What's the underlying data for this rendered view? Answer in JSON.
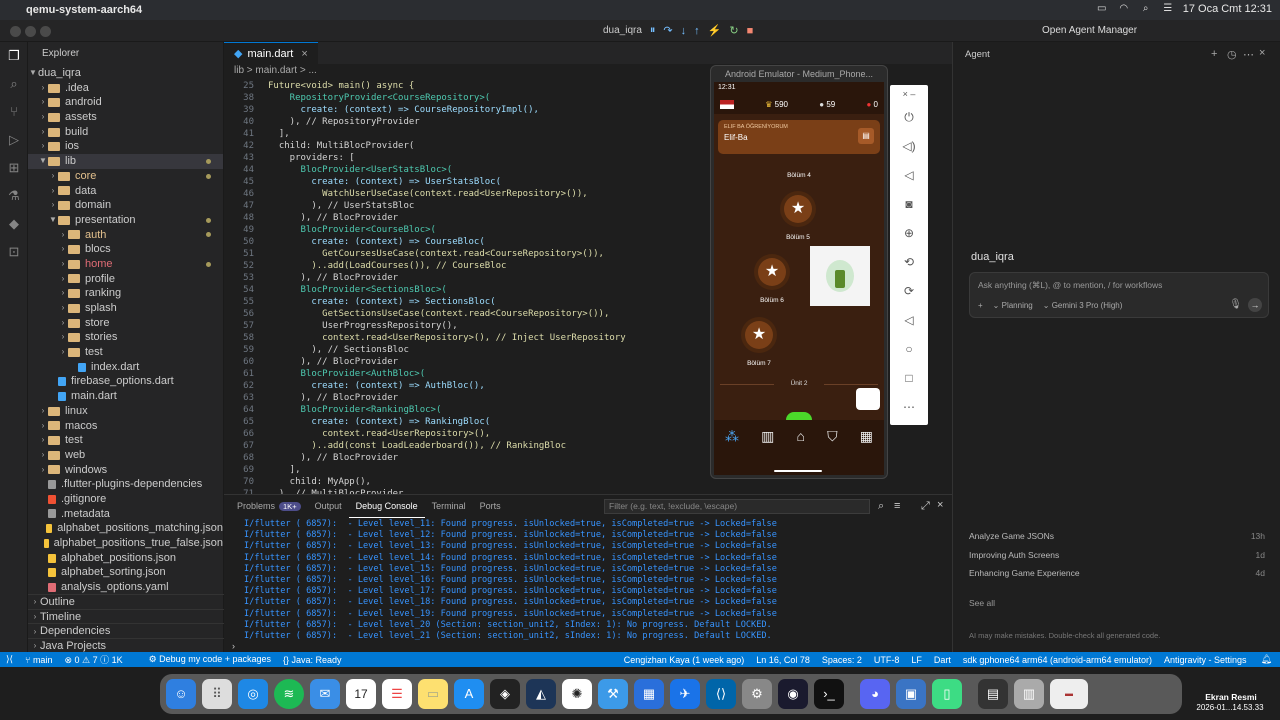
{
  "menubar": {
    "app": "qemu-system-aarch64",
    "date": "17 Oca Cmt 12:31"
  },
  "debug": {
    "label": "dua_iqra"
  },
  "explorer": {
    "title": "Explorer",
    "root": "dua_iqra",
    "items": [
      {
        "name": ".idea",
        "depth": 1,
        "type": "folder"
      },
      {
        "name": "android",
        "depth": 1,
        "type": "folder"
      },
      {
        "name": "assets",
        "depth": 1,
        "type": "folder"
      },
      {
        "name": "build",
        "depth": 1,
        "type": "folder"
      },
      {
        "name": "ios",
        "depth": 1,
        "type": "folder"
      },
      {
        "name": "lib",
        "depth": 1,
        "type": "folder-open",
        "mod": true,
        "selected": true
      },
      {
        "name": "core",
        "depth": 2,
        "type": "folder",
        "mod": true
      },
      {
        "name": "data",
        "depth": 2,
        "type": "folder"
      },
      {
        "name": "domain",
        "depth": 2,
        "type": "folder"
      },
      {
        "name": "presentation",
        "depth": 2,
        "type": "folder-open",
        "mod": true
      },
      {
        "name": "auth",
        "depth": 3,
        "type": "folder",
        "mod": true
      },
      {
        "name": "blocs",
        "depth": 3,
        "type": "folder"
      },
      {
        "name": "home",
        "depth": 3,
        "type": "folder",
        "mod": true
      },
      {
        "name": "profile",
        "depth": 3,
        "type": "folder"
      },
      {
        "name": "ranking",
        "depth": 3,
        "type": "folder"
      },
      {
        "name": "splash",
        "depth": 3,
        "type": "folder"
      },
      {
        "name": "store",
        "depth": 3,
        "type": "folder"
      },
      {
        "name": "stories",
        "depth": 3,
        "type": "folder"
      },
      {
        "name": "test",
        "depth": 3,
        "type": "folder"
      },
      {
        "name": "index.dart",
        "depth": 4,
        "type": "dart"
      },
      {
        "name": "firebase_options.dart",
        "depth": 2,
        "type": "dart"
      },
      {
        "name": "main.dart",
        "depth": 2,
        "type": "dart"
      },
      {
        "name": "linux",
        "depth": 1,
        "type": "folder"
      },
      {
        "name": "macos",
        "depth": 1,
        "type": "folder"
      },
      {
        "name": "test",
        "depth": 1,
        "type": "folder"
      },
      {
        "name": "web",
        "depth": 1,
        "type": "folder"
      },
      {
        "name": "windows",
        "depth": 1,
        "type": "folder"
      },
      {
        "name": ".flutter-plugins-dependencies",
        "depth": 1,
        "type": "file"
      },
      {
        "name": ".gitignore",
        "depth": 1,
        "type": "git"
      },
      {
        "name": ".metadata",
        "depth": 1,
        "type": "file"
      },
      {
        "name": "alphabet_positions_matching.json",
        "depth": 1,
        "type": "json"
      },
      {
        "name": "alphabet_positions_true_false.json",
        "depth": 1,
        "type": "json"
      },
      {
        "name": "alphabet_positions.json",
        "depth": 1,
        "type": "json"
      },
      {
        "name": "alphabet_sorting.json",
        "depth": 1,
        "type": "json"
      },
      {
        "name": "analysis_options.yaml",
        "depth": 1,
        "type": "yaml"
      }
    ],
    "sections": [
      "Outline",
      "Timeline",
      "Dependencies",
      "Java Projects"
    ]
  },
  "editor": {
    "tab": "main.dart",
    "crumbs": "lib > main.dart > ...",
    "lines": [
      {
        "n": "25",
        "t": "Future<void> main() async {"
      },
      {
        "n": "38",
        "t": "    RepositoryProvider<CourseRepository>("
      },
      {
        "n": "39",
        "t": "      create: (context) => CourseRepositoryImpl(),"
      },
      {
        "n": "40",
        "t": "    ), // RepositoryProvider"
      },
      {
        "n": "41",
        "t": "  ],"
      },
      {
        "n": "42",
        "t": "  child: MultiBlocProvider("
      },
      {
        "n": "43",
        "t": "    providers: ["
      },
      {
        "n": "44",
        "t": "      BlocProvider<UserStatsBloc>("
      },
      {
        "n": "45",
        "t": "        create: (context) => UserStatsBloc("
      },
      {
        "n": "46",
        "t": "          WatchUserUseCase(context.read<UserRepository>()),"
      },
      {
        "n": "47",
        "t": "        ), // UserStatsBloc"
      },
      {
        "n": "48",
        "t": "      ), // BlocProvider"
      },
      {
        "n": "49",
        "t": "      BlocProvider<CourseBloc>("
      },
      {
        "n": "50",
        "t": "        create: (context) => CourseBloc("
      },
      {
        "n": "51",
        "t": "          GetCoursesUseCase(context.read<CourseRepository>()),"
      },
      {
        "n": "52",
        "t": "        )..add(LoadCourses()), // CourseBloc"
      },
      {
        "n": "53",
        "t": "      ), // BlocProvider"
      },
      {
        "n": "54",
        "t": "      BlocProvider<SectionsBloc>("
      },
      {
        "n": "55",
        "t": "        create: (context) => SectionsBloc("
      },
      {
        "n": "56",
        "t": "          GetSectionsUseCase(context.read<CourseRepository>()),"
      },
      {
        "n": "57",
        "t": "          UserProgressRepository(),"
      },
      {
        "n": "58",
        "t": "          context.read<UserRepository>(), // Inject UserRepository"
      },
      {
        "n": "59",
        "t": "        ), // SectionsBloc"
      },
      {
        "n": "60",
        "t": "      ), // BlocProvider"
      },
      {
        "n": "61",
        "t": "      BlocProvider<AuthBloc>("
      },
      {
        "n": "62",
        "t": "        create: (context) => AuthBloc(),"
      },
      {
        "n": "63",
        "t": "      ), // BlocProvider"
      },
      {
        "n": "64",
        "t": "      BlocProvider<RankingBloc>("
      },
      {
        "n": "65",
        "t": "        create: (context) => RankingBloc("
      },
      {
        "n": "66",
        "t": "          context.read<UserRepository>(),"
      },
      {
        "n": "67",
        "t": "        )..add(const LoadLeaderboard()), // RankingBloc"
      },
      {
        "n": "68",
        "t": "      ), // BlocProvider"
      },
      {
        "n": "69",
        "t": "    ],"
      },
      {
        "n": "70",
        "t": "    child: MyApp(),"
      },
      {
        "n": "71",
        "t": "  ), // MultiBlocProvider"
      }
    ]
  },
  "panel": {
    "tabs": [
      "Problems",
      "Output",
      "Debug Console",
      "Terminal",
      "Ports"
    ],
    "problems_badge": "1K+",
    "filter_placeholder": "Filter (e.g. text, !exclude, \\escape)",
    "logs": [
      "I/flutter ( 6857):  - Level level_11: Found progress. isUnlocked=true, isCompleted=true -> Locked=false",
      "I/flutter ( 6857):  - Level level_12: Found progress. isUnlocked=true, isCompleted=true -> Locked=false",
      "I/flutter ( 6857):  - Level level_13: Found progress. isUnlocked=true, isCompleted=true -> Locked=false",
      "I/flutter ( 6857):  - Level level_14: Found progress. isUnlocked=true, isCompleted=true -> Locked=false",
      "I/flutter ( 6857):  - Level level_15: Found progress. isUnlocked=true, isCompleted=true -> Locked=false",
      "I/flutter ( 6857):  - Level level_16: Found progress. isUnlocked=true, isCompleted=true -> Locked=false",
      "I/flutter ( 6857):  - Level level_17: Found progress. isUnlocked=true, isCompleted=true -> Locked=false",
      "I/flutter ( 6857):  - Level level_18: Found progress. isUnlocked=true, isCompleted=true -> Locked=false",
      "I/flutter ( 6857):  - Level level_19: Found progress. isUnlocked=true, isCompleted=true -> Locked=false",
      "I/flutter ( 6857):  - Level level_20 (Section: section_unit2, sIndex: 1): No progress. Default LOCKED.",
      "I/flutter ( 6857):  - Level level_21 (Section: section_unit2, sIndex: 1): No progress. Default LOCKED."
    ]
  },
  "emulator": {
    "title": "Android Emulator - Medium_Phone...",
    "time": "12:31",
    "gems": "590",
    "hearts": "59",
    "streak": "0",
    "banner_sub": "ELIF BA ÖĞRENİYORUM",
    "banner_title": "Elif-Ba",
    "levels": [
      "Bölüm 4",
      "Bölüm 5",
      "Bölüm 6",
      "Bölüm 7"
    ],
    "unit": "Ünit 2"
  },
  "agent": {
    "title": "Agent",
    "manager": "Open Agent Manager",
    "workspace": "dua_iqra",
    "input_placeholder": "Ask anything (⌘L), @ to mention, / for workflows",
    "mode": "Planning",
    "model": "Gemini 3 Pro (High)",
    "history": [
      {
        "title": "Analyze Game JSONs",
        "age": "13h"
      },
      {
        "title": "Improving Auth Screens",
        "age": "1d"
      },
      {
        "title": "Enhancing Game Experience",
        "age": "4d"
      }
    ],
    "see_all": "See all",
    "disclaimer": "AI may make mistakes. Double-check all generated code."
  },
  "status": {
    "branch": "main",
    "counts": "⊗ 0 ⚠ 7 ⓘ 1K",
    "debug": "Debug my code + packages",
    "java": "Java: Ready",
    "blame": "Cengizhan Kaya (1 week ago)",
    "pos": "Ln 16, Col 78",
    "spaces": "Spaces: 2",
    "enc": "UTF-8",
    "eol": "LF",
    "lang": "Dart",
    "device": "sdk gphone64 arm64 (android-arm64 emulator)",
    "settings": "Antigravity - Settings"
  },
  "screenshot": {
    "title": "Ekran Resmi",
    "date": "2026-01...14.53.33"
  }
}
